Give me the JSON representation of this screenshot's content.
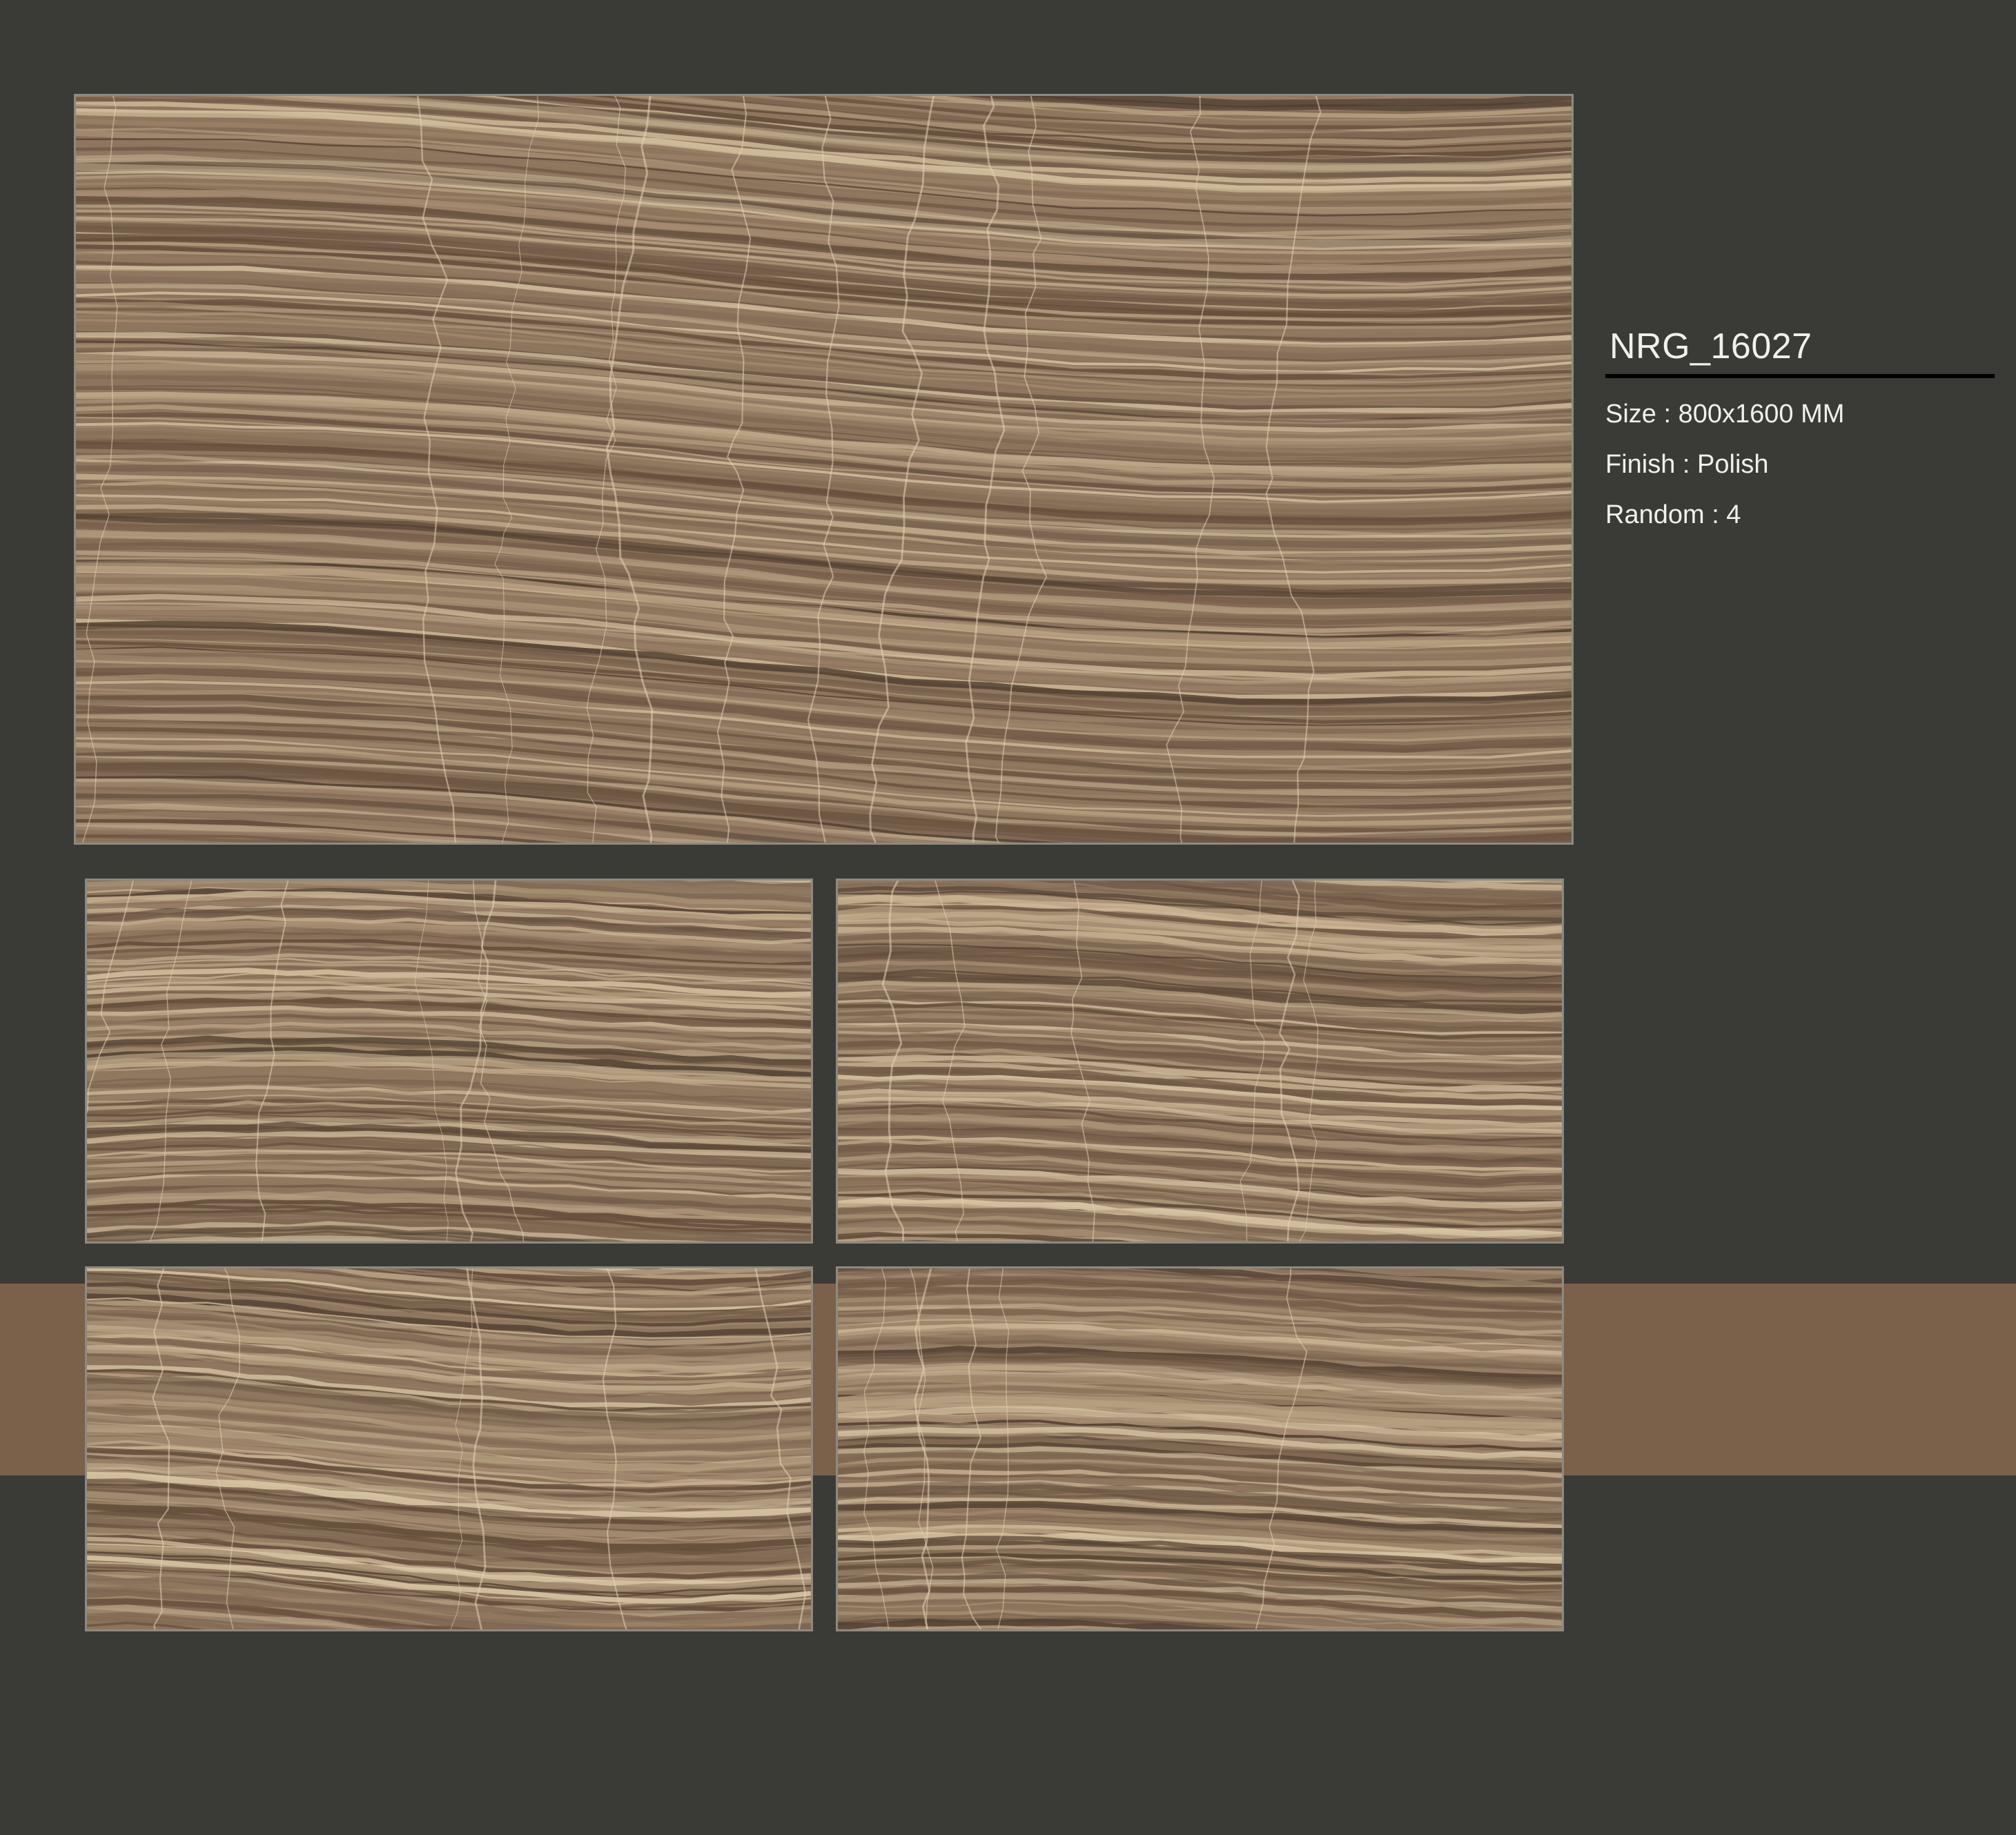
{
  "product": {
    "code": "NRG_16027",
    "specs": [
      {
        "label": "Size",
        "value": "800x1600 MM"
      },
      {
        "label": "Finish",
        "value": "Polish"
      },
      {
        "label": "Random",
        "value": "4"
      }
    ]
  },
  "specs_text": {
    "size": "Size : 800x1600 MM",
    "finish": "Finish : Polish",
    "random": "Random : 4"
  },
  "colors": {
    "background": "#3a3a36",
    "accent_band": "#7b604a",
    "tile_base": "#8c745c",
    "text": "#f2f0ec",
    "rule": "#000000"
  },
  "tiles": [
    {
      "name": "main-preview",
      "pattern": "brown onyx marble, horizontal veining"
    },
    {
      "name": "variation-1",
      "pattern": "brown onyx marble"
    },
    {
      "name": "variation-2",
      "pattern": "brown onyx marble"
    },
    {
      "name": "variation-3",
      "pattern": "brown onyx marble"
    },
    {
      "name": "variation-4",
      "pattern": "brown onyx marble"
    }
  ]
}
